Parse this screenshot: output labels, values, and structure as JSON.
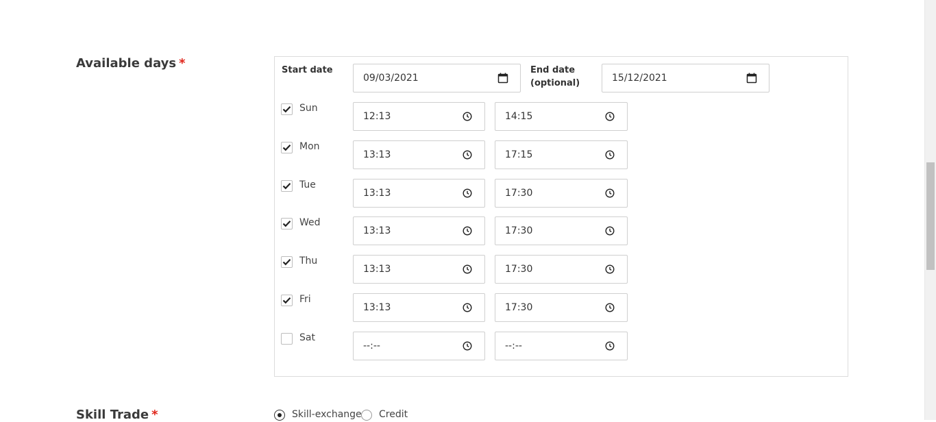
{
  "available_days": {
    "label": "Available days",
    "required_mark": "*",
    "start_date": {
      "label": "Start date",
      "value": "09/03/2021",
      "icon": "calendar-icon"
    },
    "end_date": {
      "label_line1": "End date",
      "label_line2": "(optional)",
      "value": "15/12/2021",
      "icon": "calendar-icon"
    },
    "days": [
      {
        "name": "Sun",
        "checked": true,
        "from": "12:13",
        "to": "14:15"
      },
      {
        "name": "Mon",
        "checked": true,
        "from": "13:13",
        "to": "17:15"
      },
      {
        "name": "Tue",
        "checked": true,
        "from": "13:13",
        "to": "17:30"
      },
      {
        "name": "Wed",
        "checked": true,
        "from": "13:13",
        "to": "17:30"
      },
      {
        "name": "Thu",
        "checked": true,
        "from": "13:13",
        "to": "17:30"
      },
      {
        "name": "Fri",
        "checked": true,
        "from": "13:13",
        "to": "17:30"
      },
      {
        "name": "Sat",
        "checked": false,
        "from": "--:--",
        "to": "--:--"
      }
    ]
  },
  "skill_trade": {
    "label": "Skill Trade",
    "required_mark": "*",
    "options": [
      {
        "label": "Skill-exchange",
        "selected": true
      },
      {
        "label": "Credit",
        "selected": false
      }
    ]
  },
  "colors": {
    "required": "#e0261b",
    "border": "#cfcfcf",
    "text": "#333333"
  }
}
